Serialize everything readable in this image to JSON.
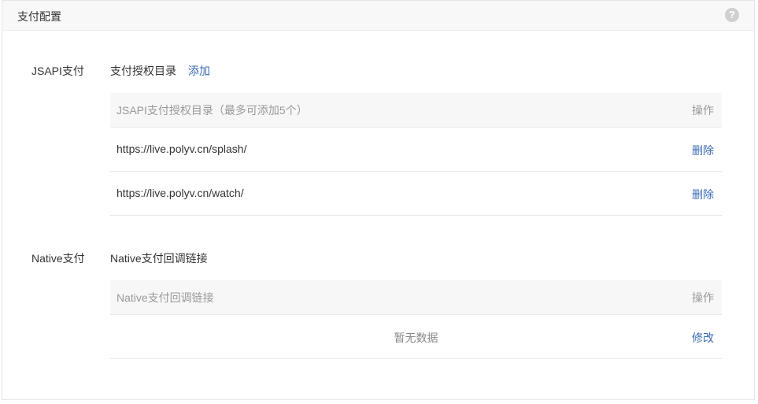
{
  "header": {
    "title": "支付配置",
    "help_icon": "?"
  },
  "jsapi": {
    "label": "JSAPI支付",
    "section_title": "支付授权目录",
    "add_label": "添加",
    "table": {
      "col_title": "JSAPI支付授权目录（最多可添加5个）",
      "col_action": "操作",
      "rows": [
        {
          "url": "https://live.polyv.cn/splash/",
          "action": "删除"
        },
        {
          "url": "https://live.polyv.cn/watch/",
          "action": "删除"
        }
      ]
    }
  },
  "native": {
    "label": "Native支付",
    "section_title": "Native支付回调链接",
    "table": {
      "col_title": "Native支付回调链接",
      "col_action": "操作",
      "empty_text": "暂无数据",
      "edit_label": "修改"
    }
  },
  "colors": {
    "link": "#3b6ab5",
    "header_bg": "#f8f8f8",
    "table_head_bg": "#f7f7f7"
  }
}
